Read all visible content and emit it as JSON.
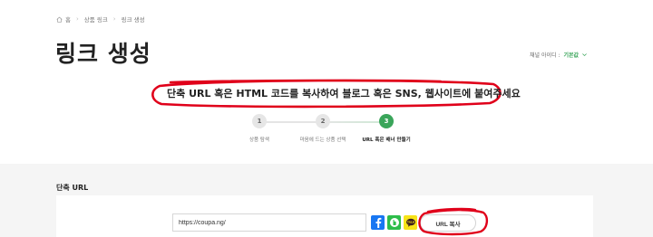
{
  "breadcrumb": {
    "items": [
      "홈",
      "상품 링크",
      "링크 생성"
    ]
  },
  "page": {
    "title": "링크 생성"
  },
  "channel": {
    "label": "채널 아이디 :",
    "value": "기본값"
  },
  "headline": "단축 URL 혹은 HTML 코드를 복사하여 블로그 혹은 SNS, 웹사이트에 붙여주세요",
  "steps": [
    {
      "number": "1",
      "label": "상품 탐색",
      "active": false
    },
    {
      "number": "2",
      "label": "마음에 드는 상품 선택",
      "active": false
    },
    {
      "number": "3",
      "label": "URL 혹은 배너 만들기",
      "active": true
    }
  ],
  "short_url": {
    "section_title": "단축 URL",
    "value": "https://coupa.ng/",
    "copy_label": "URL 복사"
  },
  "colors": {
    "accent": "#3aa55a",
    "annotation": "#e0001a",
    "facebook": "#1877f2",
    "band": "#2dbd4a",
    "kakao": "#f7e317"
  },
  "icons": [
    "home-icon",
    "chevron-right-icon",
    "chevron-down-icon",
    "facebook-icon",
    "band-icon",
    "kakaotalk-icon"
  ]
}
